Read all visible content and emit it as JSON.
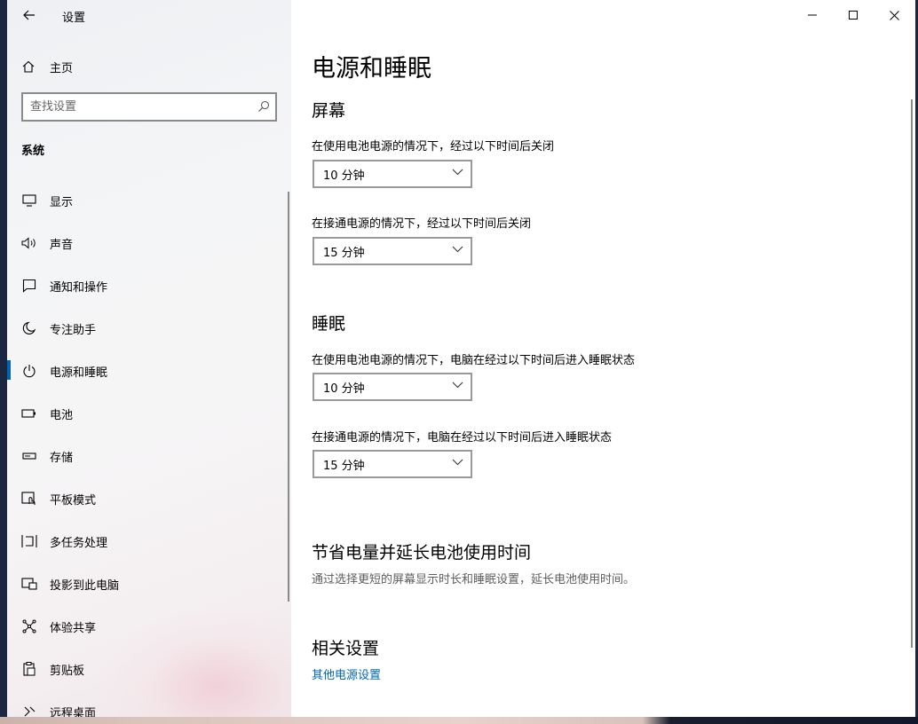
{
  "window": {
    "title": "设置"
  },
  "sidebar": {
    "home_label": "主页",
    "search_placeholder": "查找设置",
    "section_title": "系统",
    "items": [
      {
        "label": "显示",
        "icon": "monitor-icon"
      },
      {
        "label": "声音",
        "icon": "speaker-icon"
      },
      {
        "label": "通知和操作",
        "icon": "notification-icon"
      },
      {
        "label": "专注助手",
        "icon": "moon-icon"
      },
      {
        "label": "电源和睡眠",
        "icon": "power-icon",
        "active": true
      },
      {
        "label": "电池",
        "icon": "battery-icon"
      },
      {
        "label": "存储",
        "icon": "storage-icon"
      },
      {
        "label": "平板模式",
        "icon": "tablet-icon"
      },
      {
        "label": "多任务处理",
        "icon": "multitask-icon"
      },
      {
        "label": "投影到此电脑",
        "icon": "project-icon"
      },
      {
        "label": "体验共享",
        "icon": "share-icon"
      },
      {
        "label": "剪贴板",
        "icon": "clipboard-icon"
      },
      {
        "label": "远程桌面",
        "icon": "remote-desktop-icon"
      }
    ]
  },
  "main": {
    "title": "电源和睡眠",
    "screen": {
      "heading": "屏幕",
      "battery_label": "在使用电池电源的情况下，经过以下时间后关闭",
      "battery_value": "10 分钟",
      "plugged_label": "在接通电源的情况下，经过以下时间后关闭",
      "plugged_value": "15 分钟"
    },
    "sleep": {
      "heading": "睡眠",
      "battery_label": "在使用电池电源的情况下，电脑在经过以下时间后进入睡眠状态",
      "battery_value": "10 分钟",
      "plugged_label": "在接通电源的情况下，电脑在经过以下时间后进入睡眠状态",
      "plugged_value": "15 分钟"
    },
    "save_power": {
      "heading": "节省电量并延长电池使用时间",
      "description": "通过选择更短的屏幕显示时长和睡眠设置，延长电池使用时间。"
    },
    "related": {
      "heading": "相关设置",
      "link": "其他电源设置"
    }
  },
  "colors": {
    "accent": "#0063b1",
    "link": "#0066b4"
  }
}
